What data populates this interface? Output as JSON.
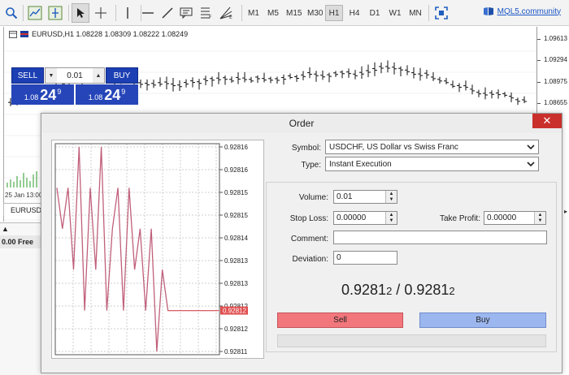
{
  "toolbar": {
    "timeframes": [
      {
        "label": "M1",
        "active": false
      },
      {
        "label": "M5",
        "active": false
      },
      {
        "label": "M15",
        "active": false
      },
      {
        "label": "M30",
        "active": false
      },
      {
        "label": "H1",
        "active": true
      },
      {
        "label": "H4",
        "active": false
      },
      {
        "label": "D1",
        "active": false
      },
      {
        "label": "W1",
        "active": false
      },
      {
        "label": "MN",
        "active": false
      }
    ],
    "community_link": "MQL5.community",
    "icons": [
      "zoom-in-icon",
      "chart-shift-icon",
      "autoscroll-icon",
      "cursor-icon",
      "crosshair-icon",
      "vertical-line-icon",
      "horizontal-line-icon",
      "trendline-icon",
      "text-label-icon",
      "fibonacci-icon",
      "gann-icon",
      "fullscreen-icon",
      "community-icon"
    ]
  },
  "chart": {
    "title": "EURUSD,H1  1.08228 1.08309 1.08222 1.08249",
    "price_scale": [
      "1.09613",
      "1.09294",
      "1.08975",
      "1.08655"
    ],
    "date_label": "25 Jan 13:00",
    "tab_label": "EURUSD",
    "one_click": {
      "sell_label": "SELL",
      "buy_label": "BUY",
      "volume": "0.01",
      "sell_price_small": "1.08",
      "sell_price_big": "24",
      "sell_price_sup": "9",
      "buy_price_small": "1.08",
      "buy_price_big": "24",
      "buy_price_sup": "9"
    }
  },
  "bottom": {
    "strip_text": "0.00  Free"
  },
  "dialog": {
    "title": "Order",
    "close_label": "✕",
    "symbol_label": "Symbol:",
    "symbol_value": "USDCHF, US Dollar vs Swiss Franc",
    "type_label": "Type:",
    "type_value": "Instant Execution",
    "volume_label": "Volume:",
    "volume_value": "0.01",
    "stop_loss_label": "Stop Loss:",
    "stop_loss_value": "0.00000",
    "take_profit_label": "Take Profit:",
    "take_profit_value": "0.00000",
    "comment_label": "Comment:",
    "comment_value": "",
    "deviation_label": "Deviation:",
    "deviation_value": "0",
    "quote_bid_main": "0.9281",
    "quote_bid_small": "2",
    "quote_sep": " / ",
    "quote_ask_main": "0.9281",
    "quote_ask_small": "2",
    "sell_label": "Sell",
    "buy_label": "Buy"
  },
  "chart_data": {
    "type": "line",
    "y_ticks": [
      "0.92816",
      "0.92816",
      "0.92815",
      "0.92815",
      "0.92814",
      "0.92813",
      "0.92813",
      "0.92812",
      "0.92812",
      "0.92811"
    ],
    "current_price_label": "0.92812",
    "ylim": [
      0.92811,
      0.92816
    ],
    "grid": true,
    "series": [
      {
        "values": [
          0.92815,
          0.92814,
          0.92815,
          0.92813,
          0.92816,
          0.92812,
          0.92815,
          0.92813,
          0.92816,
          0.92812,
          0.92814,
          0.92815,
          0.92812,
          0.92815,
          0.92813,
          0.92814,
          0.92812,
          0.92814,
          0.92811,
          0.92813,
          0.92812,
          0.92812,
          0.92812,
          0.92812,
          0.92812,
          0.92812,
          0.92812,
          0.92812,
          0.92812,
          0.92812
        ]
      }
    ],
    "colors": {
      "line": "#c0607a",
      "price_line": "#e06060",
      "price_label_bg": "#e05050"
    }
  }
}
